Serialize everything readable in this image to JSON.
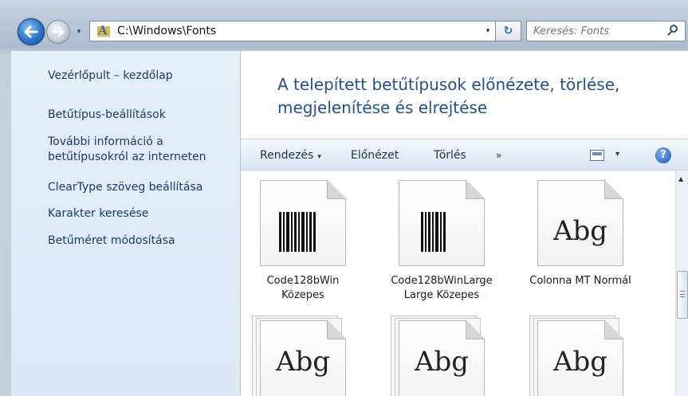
{
  "address_bar": {
    "path": "C:\\Windows\\Fonts",
    "search_placeholder": "Keresés: Fonts",
    "dropdown_arrow": "▾",
    "refresh_glyph": "↻",
    "recent_glyph": "▾"
  },
  "sidebar": {
    "items": [
      {
        "label": "Vezérlőpult – kezdőlap"
      },
      {
        "label": "Betűtípus-beállítások"
      },
      {
        "label": "További információ a betűtípusokról az interneten"
      },
      {
        "label": "ClearType szöveg beállítása"
      },
      {
        "label": "Karakter keresése"
      },
      {
        "label": "Betűméret módosítása"
      }
    ]
  },
  "main": {
    "heading": "A telepített betűtípusok előnézete, törlése, megjelenítése és elrejtése"
  },
  "toolbar": {
    "organize_label": "Rendezés",
    "organize_arrow": "▾",
    "preview_label": "Előnézet",
    "delete_label": "Törlés",
    "more_label": "»",
    "views_arrow": "▾",
    "help_label": "?"
  },
  "fonts": [
    {
      "name": "Code128bWin Közepes",
      "icon": "barcode-icon"
    },
    {
      "name": "Code128bWinLarge Large Közepes",
      "icon": "barcode-icon"
    },
    {
      "name": "Colonna MT Normál",
      "icon": "font-preview-icon",
      "sample": "Abg"
    },
    {
      "name": "",
      "icon": "font-stack-icon",
      "sample": "Abg"
    },
    {
      "name": "",
      "icon": "font-stack-icon",
      "sample": "Abg"
    },
    {
      "name": "",
      "icon": "font-stack-icon",
      "sample": "Abg"
    }
  ],
  "colors": {
    "link": "#1e3a66",
    "heading": "#1f4f9b",
    "sidebar_bg": "#dbe8f6"
  }
}
